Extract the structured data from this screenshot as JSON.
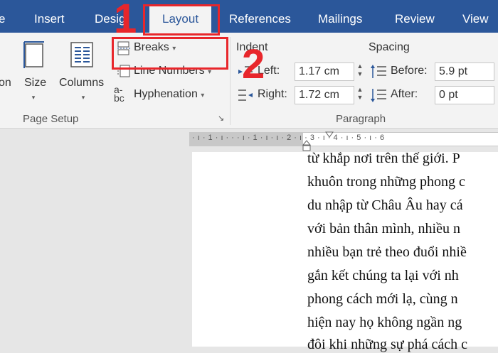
{
  "tabs": [
    {
      "label": "e"
    },
    {
      "label": "Insert"
    },
    {
      "label": "Desig"
    },
    {
      "label": "Layout"
    },
    {
      "label": "References"
    },
    {
      "label": "Mailings"
    },
    {
      "label": "Review"
    },
    {
      "label": "View"
    }
  ],
  "page_setup": {
    "orientation_label": "on",
    "size_label": "Size",
    "columns_label": "Columns",
    "breaks_label": "Breaks",
    "line_numbers_label": "Line Numbers",
    "hyphenation_label": "Hyphenation",
    "group_label": "Page Setup",
    "launcher_glyph": "↘"
  },
  "paragraph": {
    "indent_label": "Indent",
    "spacing_label": "Spacing",
    "left_label": "Left:",
    "right_label": "Right:",
    "before_label": "Before:",
    "after_label": "After:",
    "left_value": "1.17 cm",
    "right_value": "1.72 cm",
    "before_value": "5.9 pt",
    "after_value": "0 pt",
    "group_label": "Paragraph"
  },
  "annotations": {
    "step1": "1",
    "step2": "2"
  },
  "ruler": {
    "text": "· ı · 1 · ı · · · ı · 1 · ı · ı · 2 · ı · 3 · ı · 4 · ı · 5 · ı · 6"
  },
  "document": {
    "lines": [
      "từ khắp nơi trên thế giới. P",
      "khuôn trong những phong c",
      "du nhập từ Châu Âu hay cá",
      "với bản thân mình, nhiều n",
      "nhiều bạn trẻ theo đuổi nhiề",
      "gắn kết chúng ta lại với nh",
      "phong cách mới lạ, cùng n",
      "hiện nay họ không ngần ng",
      "đôi khi những sự phá cách c"
    ]
  },
  "colors": {
    "ribbon_blue": "#2b579a",
    "annotation_red": "#e8262b"
  }
}
